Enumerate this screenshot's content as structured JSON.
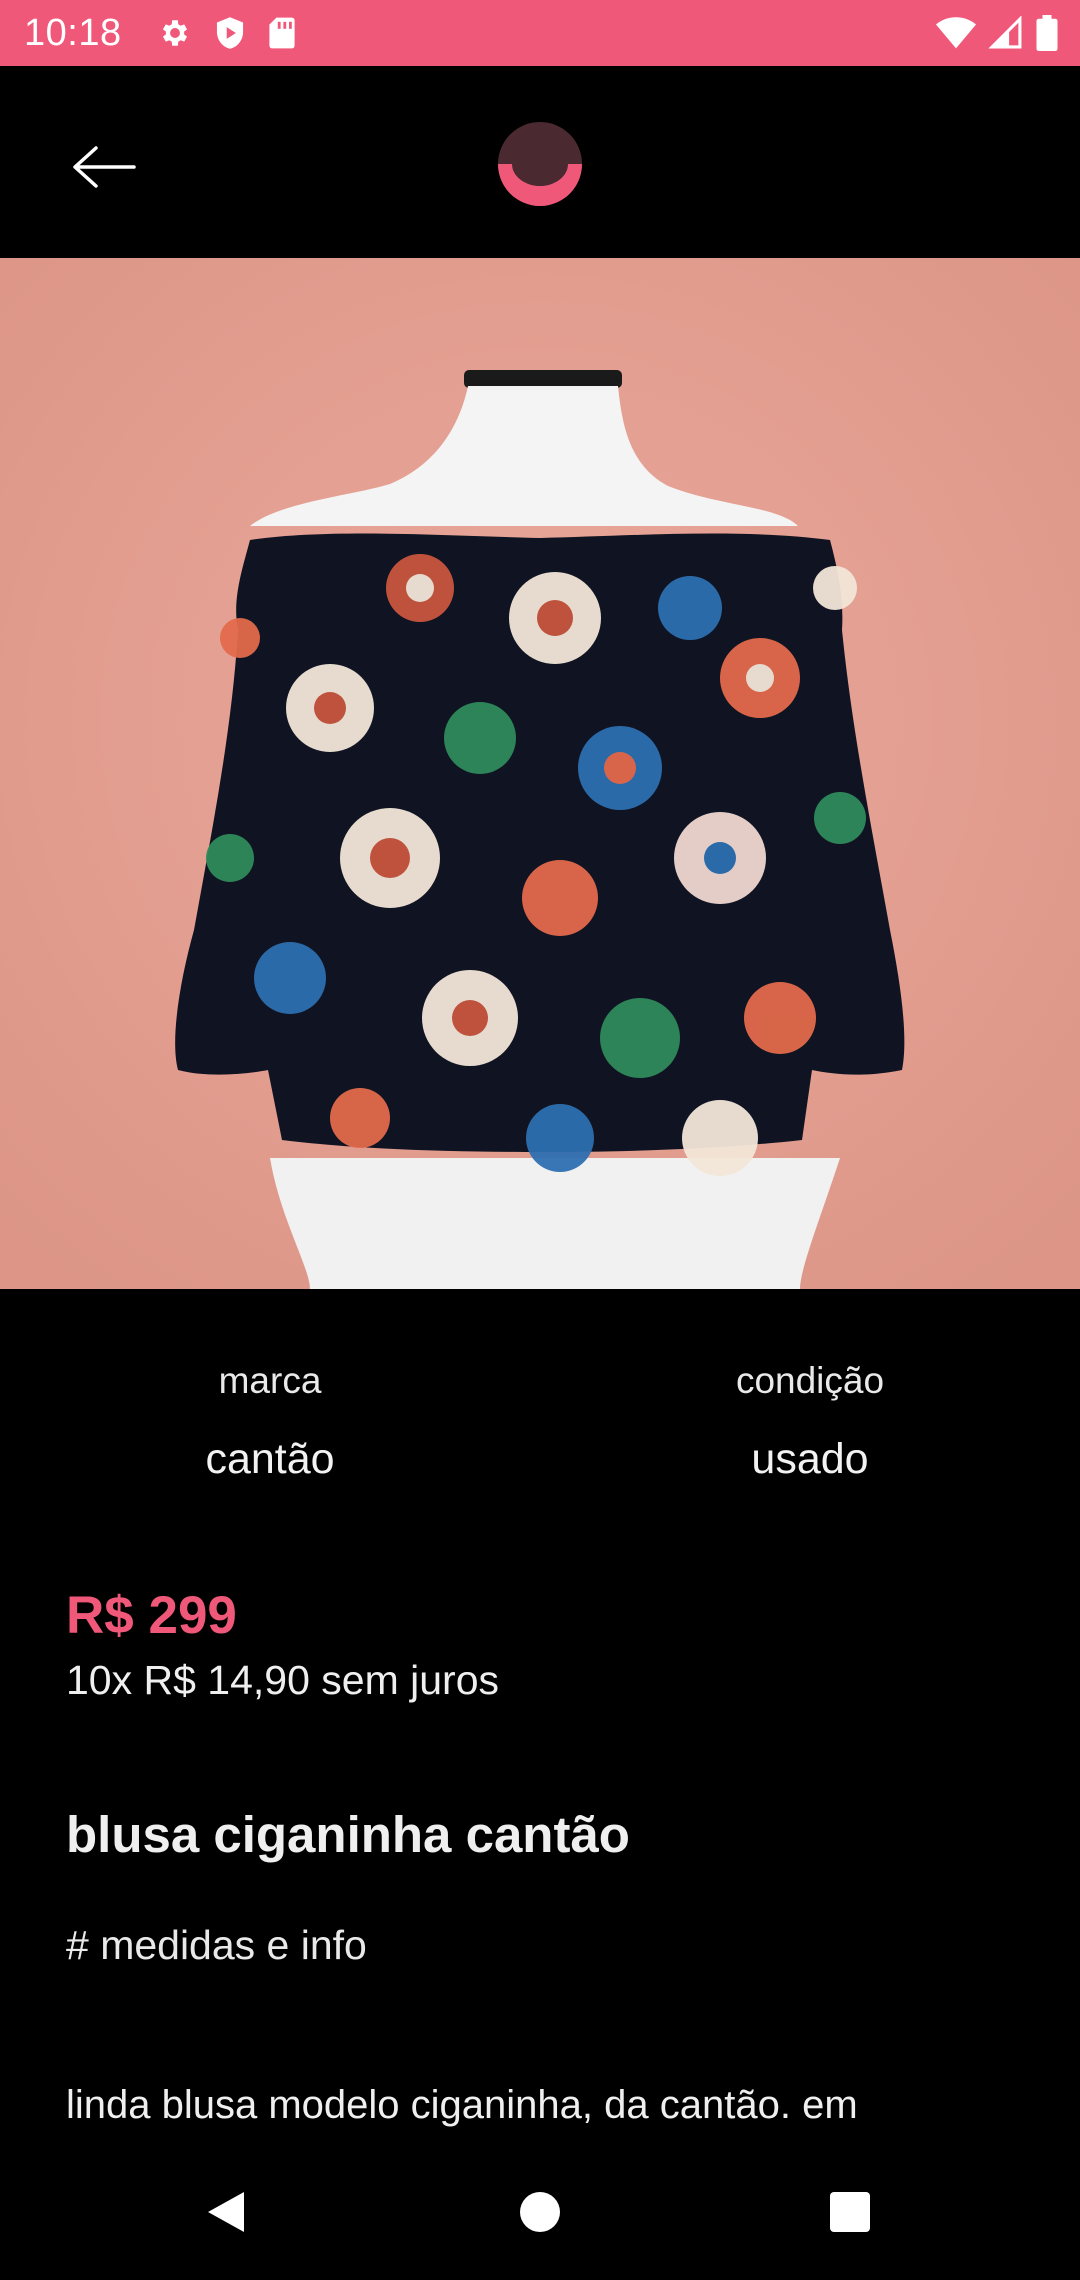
{
  "status_bar": {
    "time": "10:18",
    "left_icons": [
      "gear-icon",
      "shield-play-icon",
      "sd-card-icon"
    ],
    "right_icons": [
      "wifi-icon",
      "cell-signal-icon",
      "battery-icon"
    ],
    "background": "#f0587a"
  },
  "app_bar": {
    "back_icon": "arrow-left-icon",
    "logo_icon": "smile-logo-icon"
  },
  "product": {
    "image_description_icon": "product-photo",
    "attributes": [
      {
        "label": "marca",
        "value": "cantão"
      },
      {
        "label": "condição",
        "value": "usado"
      }
    ],
    "price": "R$ 299",
    "installments": "10x R$ 14,90 sem juros",
    "title": "blusa ciganinha cantão",
    "measures_label": "# medidas e info",
    "description": "linda blusa modelo ciganinha, da cantão. em"
  },
  "nav_bar": {
    "icons": [
      "nav-back-icon",
      "nav-home-icon",
      "nav-recents-icon"
    ]
  },
  "colors": {
    "accent": "#f0587a",
    "background": "#000000",
    "image_backdrop": "#e4a294"
  }
}
